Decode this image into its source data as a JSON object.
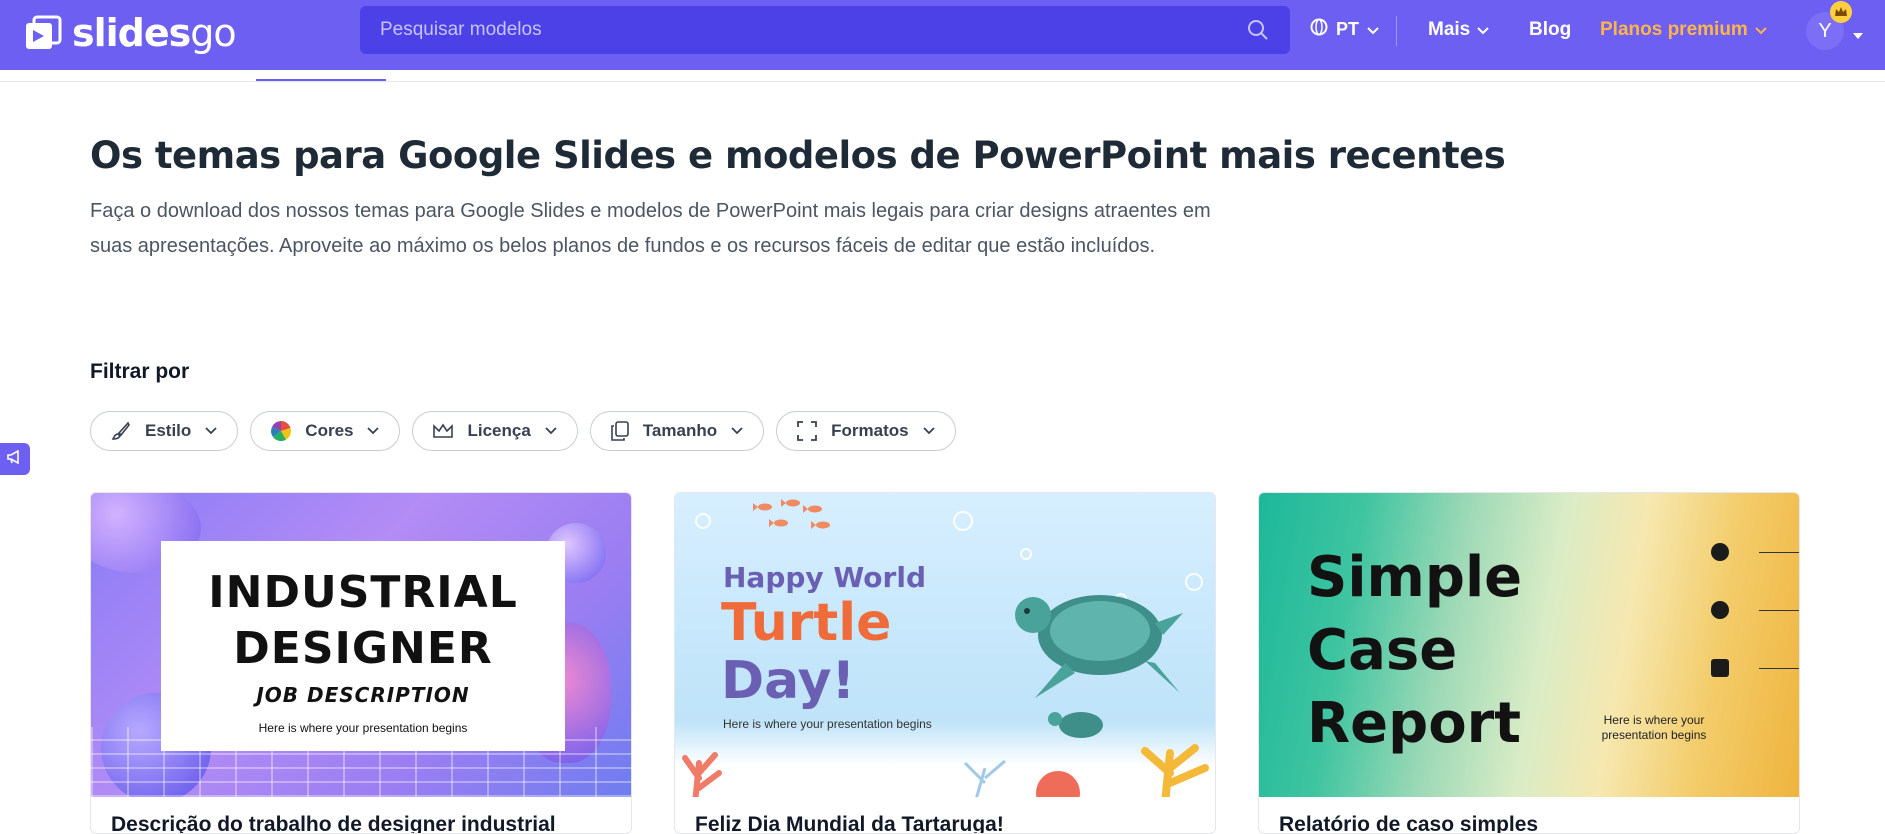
{
  "brand": {
    "logo_text_a": "slides",
    "logo_text_b": "go"
  },
  "search": {
    "placeholder": "Pesquisar modelos"
  },
  "nav": {
    "language": "PT",
    "more": "Mais",
    "blog": "Blog",
    "premium": "Planos premium",
    "avatar_initial": "Y"
  },
  "colors": {
    "primary": "#6c5ff2",
    "premium": "#ffb547",
    "search_bg": "#4b41e6"
  },
  "main": {
    "title": "Os temas para Google Slides e modelos de PowerPoint mais recentes",
    "description": "Faça o download dos nossos temas para Google Slides e modelos de PowerPoint mais legais para criar designs atraentes em suas apresentações. Aproveite ao máximo os belos planos de fundos e os recursos fáceis de editar que estão incluídos.",
    "filter_label": "Filtrar por",
    "filters": [
      {
        "label": "Estilo",
        "icon": "brush-icon"
      },
      {
        "label": "Cores",
        "icon": "color-wheel-icon"
      },
      {
        "label": "Licença",
        "icon": "crown-icon"
      },
      {
        "label": "Tamanho",
        "icon": "copy-icon"
      },
      {
        "label": "Formatos",
        "icon": "frame-icon"
      }
    ]
  },
  "cards": [
    {
      "thumb_lines": [
        "INDUSTRIAL",
        "DESIGNER",
        "JOB DESCRIPTION",
        "Here is where your presentation begins"
      ],
      "title": "Descrição do trabalho de designer industrial"
    },
    {
      "thumb_lines": [
        "Happy World",
        "Turtle",
        "Day!",
        "Here is where your presentation begins"
      ],
      "title": "Feliz Dia Mundial da Tartaruga!"
    },
    {
      "thumb_lines": [
        "Simple",
        "Case",
        "Report",
        "Here is where your presentation begins"
      ],
      "title": "Relatório de caso simples"
    }
  ]
}
